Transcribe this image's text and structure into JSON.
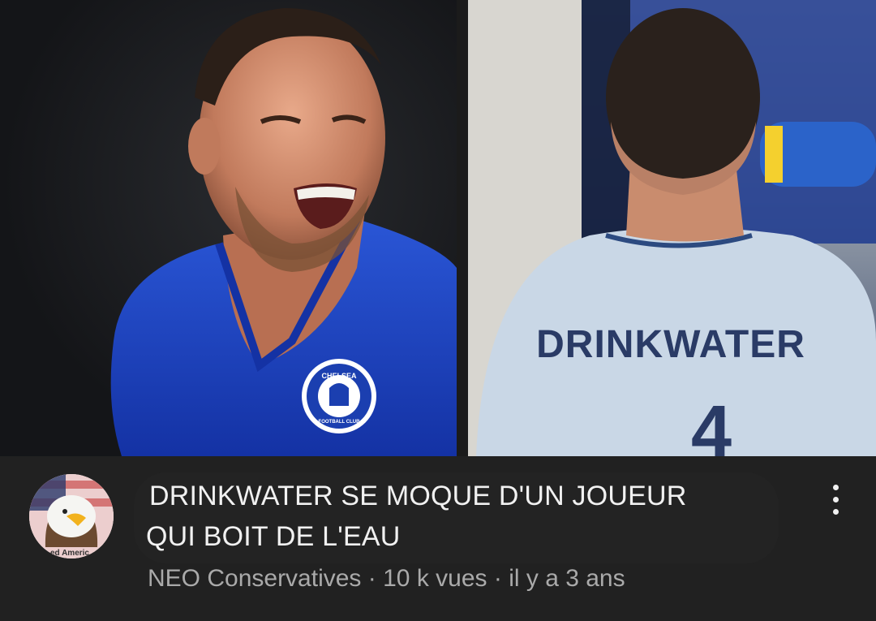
{
  "video": {
    "title_line1": "DRINKWATER SE MOQUE D'UN JOUEUR",
    "title_line2": "QUI BOIT DE L'EAU",
    "channel": "NEO Conservatives",
    "views": "10 k vues",
    "age": "il y a 3 ans",
    "separator": " · "
  },
  "thumbnail": {
    "crest_text_top": "CHELSEA",
    "crest_text_bottom": "FOOTBALL CLUB",
    "shirt_name": "DRINKWATER",
    "shirt_number": "4"
  },
  "avatar": {
    "badge_text": "ed Americ"
  },
  "icons": {
    "menu": "more-vert-icon"
  },
  "colors": {
    "background": "#212121",
    "title": "#f1f1f1",
    "subtitle": "#aaaaaa",
    "chelsea_blue": "#1b3fb0"
  }
}
